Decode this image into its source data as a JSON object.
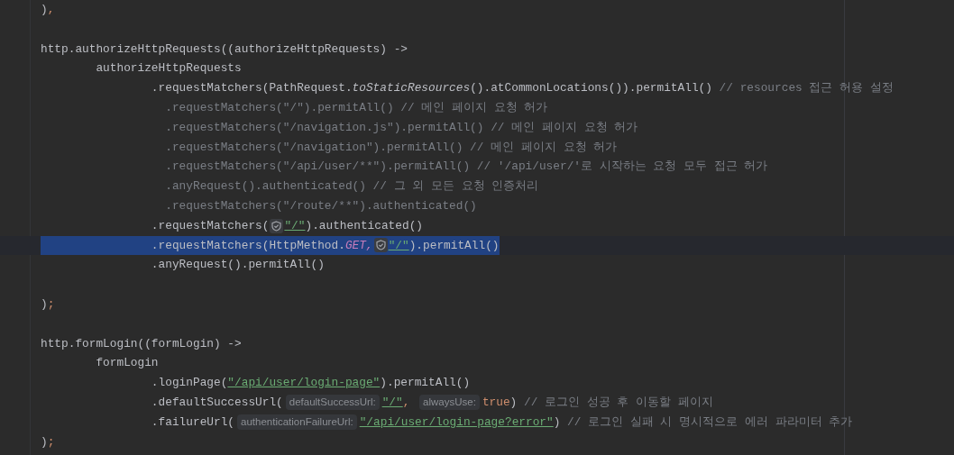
{
  "editor": {
    "lines": [
      {
        "selected": false,
        "tokens": [
          {
            "kind": "plain",
            "text": ")"
          },
          {
            "kind": "keyword",
            "text": ","
          }
        ]
      },
      {
        "selected": false
      },
      {
        "selected": false,
        "tokens": [
          {
            "kind": "plain",
            "text": "http.authorizeHttpRequests((authorizeHttpRequests) ->"
          }
        ]
      },
      {
        "selected": false,
        "tokens": [
          {
            "kind": "plain",
            "text": "        authorizeHttpRequests"
          }
        ]
      },
      {
        "selected": false,
        "tokens": [
          {
            "kind": "plain",
            "text": "                .requestMatchers(PathRequest."
          },
          {
            "kind": "italic",
            "text": "toStaticResources"
          },
          {
            "kind": "plain",
            "text": "().atCommonLocations()).permitAll() "
          },
          {
            "kind": "comment",
            "text": "// resources 접근 허용 설정"
          }
        ]
      },
      {
        "selected": false,
        "tokens": [
          {
            "kind": "comment",
            "text": "                  .requestMatchers(\"/\").permitAll() // 메인 페이지 요청 허가"
          }
        ]
      },
      {
        "selected": false,
        "tokens": [
          {
            "kind": "comment",
            "text": "                  .requestMatchers(\"/navigation.js\").permitAll() // 메인 페이지 요청 허가"
          }
        ]
      },
      {
        "selected": false,
        "tokens": [
          {
            "kind": "comment",
            "text": "                  .requestMatchers(\"/navigation\").permitAll() // 메인 페이지 요청 허가"
          }
        ]
      },
      {
        "selected": false,
        "tokens": [
          {
            "kind": "comment",
            "text": "                  .requestMatchers(\"/api/user/**\").permitAll() // '/api/user/'로 시작하는 요청 모두 접근 허가"
          }
        ]
      },
      {
        "selected": false,
        "tokens": [
          {
            "kind": "comment",
            "text": "                  .anyRequest().authenticated() // 그 외 모든 요청 인증처리"
          }
        ]
      },
      {
        "selected": false,
        "tokens": [
          {
            "kind": "comment",
            "text": "                  .requestMatchers(\"/route/**\").authenticated()"
          }
        ]
      },
      {
        "selected": false,
        "tokens": [
          {
            "kind": "plain",
            "text": "                .requestMatchers("
          },
          {
            "kind": "shield"
          },
          {
            "kind": "link",
            "text": "\"/\""
          },
          {
            "kind": "plain",
            "text": ").authenticated()"
          }
        ]
      },
      {
        "selected": true,
        "tokens": [
          {
            "kind": "plain",
            "text": "                .requestMatchers(HttpMethod."
          },
          {
            "kind": "constant",
            "text": "GET,"
          },
          {
            "kind": "shield"
          },
          {
            "kind": "link",
            "text": "\"/\""
          },
          {
            "kind": "plain",
            "text": ").permitAll()"
          }
        ]
      },
      {
        "selected": false,
        "tokens": [
          {
            "kind": "plain",
            "text": "                .anyRequest().permitAll()"
          }
        ]
      },
      {
        "selected": false
      },
      {
        "selected": false,
        "tokens": [
          {
            "kind": "plain",
            "text": ")"
          },
          {
            "kind": "keyword",
            "text": ";"
          }
        ]
      },
      {
        "selected": false
      },
      {
        "selected": false,
        "tokens": [
          {
            "kind": "plain",
            "text": "http.formLogin((formLogin) ->"
          }
        ]
      },
      {
        "selected": false,
        "tokens": [
          {
            "kind": "plain",
            "text": "        formLogin"
          }
        ]
      },
      {
        "selected": false,
        "tokens": [
          {
            "kind": "plain",
            "text": "                .loginPage("
          },
          {
            "kind": "link",
            "text": "\"/api/user/login-page\""
          },
          {
            "kind": "plain",
            "text": ").permitAll()"
          }
        ]
      },
      {
        "selected": false,
        "tokens": [
          {
            "kind": "plain",
            "text": "                .defaultSuccessUrl("
          },
          {
            "kind": "hint",
            "text": "defaultSuccessUrl:"
          },
          {
            "kind": "link",
            "text": "\"/\""
          },
          {
            "kind": "keyword",
            "text": ", "
          },
          {
            "kind": "hint",
            "text": "alwaysUse:"
          },
          {
            "kind": "keyword",
            "text": "true"
          },
          {
            "kind": "plain",
            "text": ") "
          },
          {
            "kind": "comment",
            "text": "// 로그인 성공 후 이동할 페이지"
          }
        ]
      },
      {
        "selected": false,
        "tokens": [
          {
            "kind": "plain",
            "text": "                .failureUrl("
          },
          {
            "kind": "hint",
            "text": "authenticationFailureUrl:"
          },
          {
            "kind": "link",
            "text": "\"/api/user/login-page?error\""
          },
          {
            "kind": "plain",
            "text": ") "
          },
          {
            "kind": "comment",
            "text": "// 로그인 실패 시 명시적으로 에러 파라미터 추가"
          }
        ]
      },
      {
        "selected": false,
        "tokens": [
          {
            "kind": "plain",
            "text": ")"
          },
          {
            "kind": "keyword",
            "text": ";"
          }
        ]
      }
    ]
  }
}
